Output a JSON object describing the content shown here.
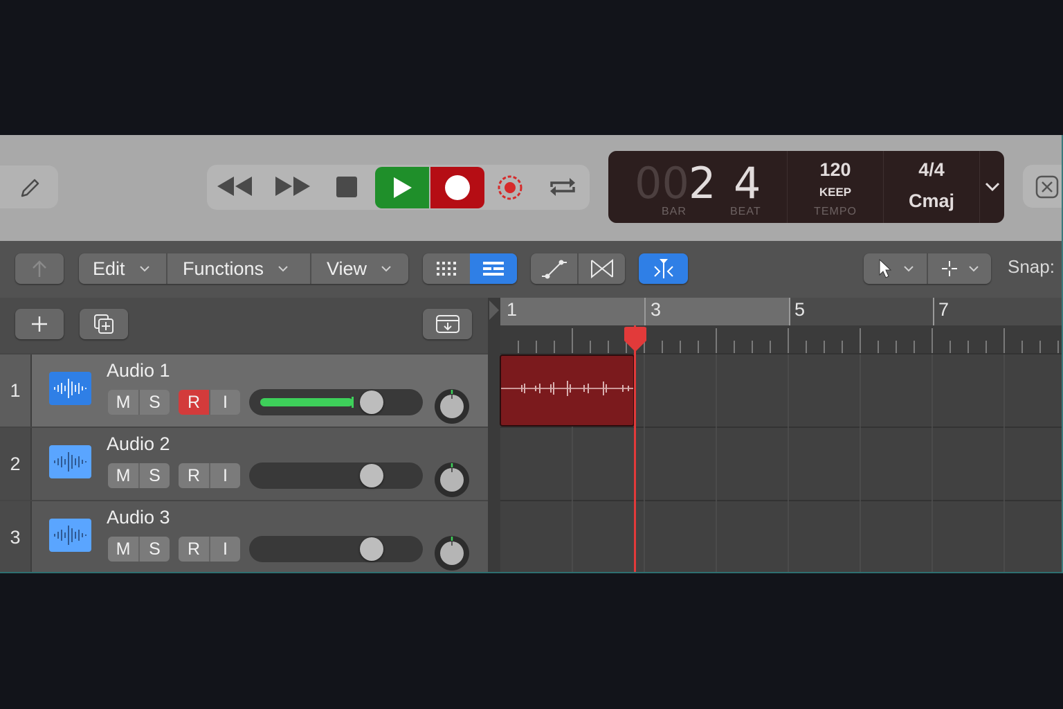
{
  "transport": {
    "pencil_icon": "pencil-icon",
    "buttons": [
      "rewind",
      "fast-forward",
      "stop",
      "play",
      "record",
      "replace-record",
      "cycle"
    ],
    "lcd": {
      "bar_prefix": "00",
      "bar_value": "2",
      "beat_value": "4",
      "bar_label": "BAR",
      "beat_label": "BEAT",
      "tempo_value": "120",
      "tempo_mode": "KEEP",
      "tempo_label": "TEMPO",
      "time_signature": "4/4",
      "key": "Cmaj"
    }
  },
  "controlbar": {
    "menus": [
      {
        "label": "Edit"
      },
      {
        "label": "Functions"
      },
      {
        "label": "View"
      }
    ],
    "snap_label": "Snap:"
  },
  "tracks": [
    {
      "number": "1",
      "name": "Audio 1",
      "mute": "M",
      "solo": "S",
      "record": "R",
      "input": "I",
      "volume_fraction": 0.6,
      "record_armed": true,
      "selected": true
    },
    {
      "number": "2",
      "name": "Audio 2",
      "mute": "M",
      "solo": "S",
      "record": "R",
      "input": "I",
      "volume_fraction": 0.0,
      "record_armed": false,
      "selected": false
    },
    {
      "number": "3",
      "name": "Audio 3",
      "mute": "M",
      "solo": "S",
      "record": "R",
      "input": "I",
      "volume_fraction": 0.0,
      "record_armed": false,
      "selected": false
    }
  ],
  "ruler": {
    "bar_numbers": [
      "1",
      "3",
      "5",
      "7"
    ]
  },
  "colors": {
    "play": "#1f8f2a",
    "record": "#b50d14",
    "accent_blue": "#2f7fe6",
    "region": "#7b1a1d",
    "playhead": "#e23a3a",
    "meter_green": "#3ed05a"
  }
}
